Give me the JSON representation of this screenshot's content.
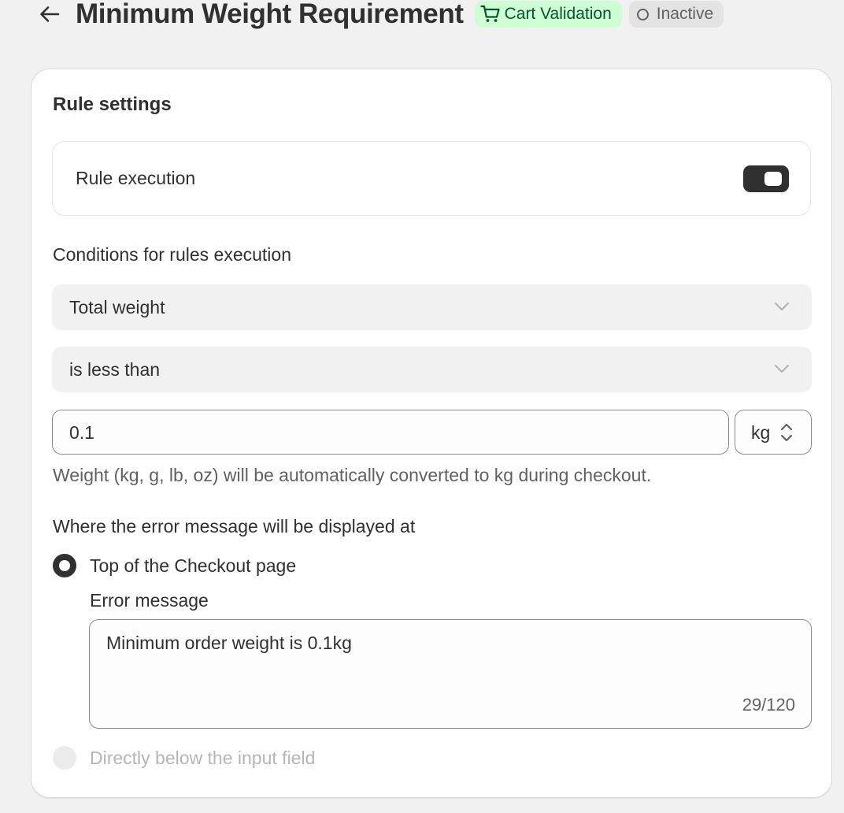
{
  "header": {
    "title": "Minimum Weight Requirement",
    "type_badge": "Cart Validation",
    "status_badge": "Inactive",
    "colors": {
      "type_badge_bg": "#cdfed4",
      "type_badge_text": "#0c5132",
      "status_badge_bg": "#e3e3e3"
    }
  },
  "card": {
    "title": "Rule settings",
    "rule_execution": {
      "label": "Rule execution",
      "enabled": true
    },
    "conditions": {
      "label": "Conditions for rules execution",
      "field_select": "Total weight",
      "operator_select": "is less than",
      "value": "0.1",
      "unit": "kg",
      "help_text": "Weight (kg, g, lb, oz) will be automatically converted to kg during checkout."
    },
    "error_display": {
      "label": "Where the error message will be displayed at",
      "options": [
        {
          "label": "Top of the Checkout page",
          "selected": true,
          "disabled": false
        },
        {
          "label": "Directly below the input field",
          "selected": false,
          "disabled": true
        }
      ],
      "error_message_label": "Error message",
      "error_message": "Minimum order weight is 0.1kg",
      "char_count": "29/120"
    }
  },
  "icons": {
    "back": "arrow-left-icon",
    "cart": "cart-icon",
    "status": "circle-outline-icon",
    "chevron": "chevron-down-icon",
    "unit": "select-arrows-icon"
  }
}
